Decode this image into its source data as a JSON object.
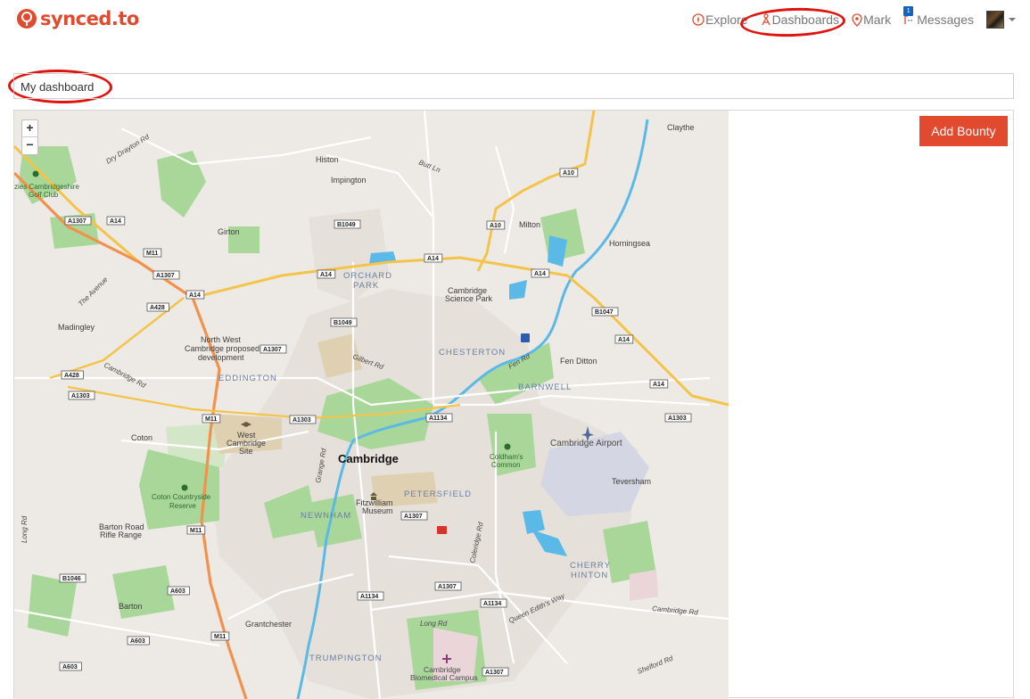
{
  "brand": {
    "name": "synced.to",
    "accent": "#e04a2f"
  },
  "nav": {
    "items": [
      {
        "label": "Explore",
        "icon": "explore-icon"
      },
      {
        "label": "Dashboards",
        "icon": "dashboards-icon"
      },
      {
        "label": "Mark",
        "icon": "map-pin-icon"
      },
      {
        "label": "Messages",
        "icon": "messages-icon",
        "badge": "1"
      }
    ],
    "user_menu": {
      "icon": "avatar"
    }
  },
  "dashboard": {
    "title": "My dashboard"
  },
  "map": {
    "zoom_in": "+",
    "zoom_out": "−",
    "places": {
      "cambridge": "Cambridge",
      "histon": "Histon",
      "impington": "Impington",
      "girton": "Girton",
      "milton": "Milton",
      "horningsea": "Horningsea",
      "claythe": "Claythe",
      "madingley": "Madingley",
      "fen_ditton": "Fen Ditton",
      "coton": "Coton",
      "teversham": "Teversham",
      "barton": "Barton",
      "grantchester": "Grantchester",
      "orchard_park": [
        "ORCHARD",
        "PARK"
      ],
      "chesterton": "CHESTERTON",
      "eddington": "EDDINGTON",
      "barnwell": "BARNWELL",
      "petersfield": "PETERSFIELD",
      "newnham": "NEWNHAM",
      "cherry_hinton": [
        "CHERRY",
        "HINTON"
      ],
      "trumpington": "TRUMPINGTON",
      "science_park": [
        "Cambridge",
        "Science Park"
      ],
      "nw_cambridge": [
        "North West",
        "Cambridge proposed",
        "development"
      ],
      "west_site": [
        "West",
        "Cambridge",
        "Site"
      ],
      "golf": [
        "zies Cambridgeshire",
        "Golf Club"
      ],
      "coton_reserve": [
        "Coton Countryside",
        "Reserve"
      ],
      "barton_range": [
        "Barton Road",
        "Rifle Range"
      ],
      "coldhams": [
        "Coldham's",
        "Common"
      ],
      "fitzwilliam": [
        "Fitzwilliam",
        "Museum"
      ],
      "airport": "Cambridge Airport",
      "biomedical": [
        "Cambridge",
        "Biomedical Campus"
      ]
    },
    "roads": {
      "dry_drayton": "Dry Drayton Rd",
      "butt_ln": "Butt Ln",
      "the_avenue": "The Avenue",
      "cambridge_rd": "Cambridge Rd",
      "gilbert_rd": "Gilbert Rd",
      "fen_rd": "Fen Rd",
      "grange_rd": "Grange Rd",
      "long_rd": "Long Rd",
      "queen_ediths": "Queen Edith's Way",
      "cambridge_rd_e": "Cambridge Rd",
      "shelford_rd": "Shelford Rd",
      "long_rd_w": "Long Rd",
      "coleridge_rd": "Coleridge Rd"
    },
    "shields": {
      "a1307_a": "A1307",
      "a14_a": "A14",
      "m11_a": "M11",
      "a1307_b": "A1307",
      "a14_b": "A14",
      "a428_a": "A428",
      "a428_b": "A428",
      "a1303_a": "A1303",
      "b1049_a": "B1049",
      "a10_a": "A10",
      "a10_b": "A10",
      "a14_c": "A14",
      "a14_d": "A14",
      "a14_e": "A14",
      "b1047": "B1047",
      "a14_f": "A14",
      "a14_g": "A14",
      "b1049_b": "B1049",
      "a1307_c": "A1307",
      "m11_b": "M11",
      "a1303_b": "A1303",
      "a1134_a": "A1134",
      "a1303_c": "A1303",
      "m11_c": "M11",
      "a1307_d": "A1307",
      "b1046": "B1046",
      "a603_a": "A603",
      "a1134_b": "A1134",
      "a1307_e": "A1307",
      "a1134_c": "A1134",
      "m11_d": "M11",
      "a603_b": "A603",
      "a603_c": "A603",
      "a1307_f": "A1307"
    }
  },
  "actions": {
    "add_bounty": "Add Bounty"
  }
}
